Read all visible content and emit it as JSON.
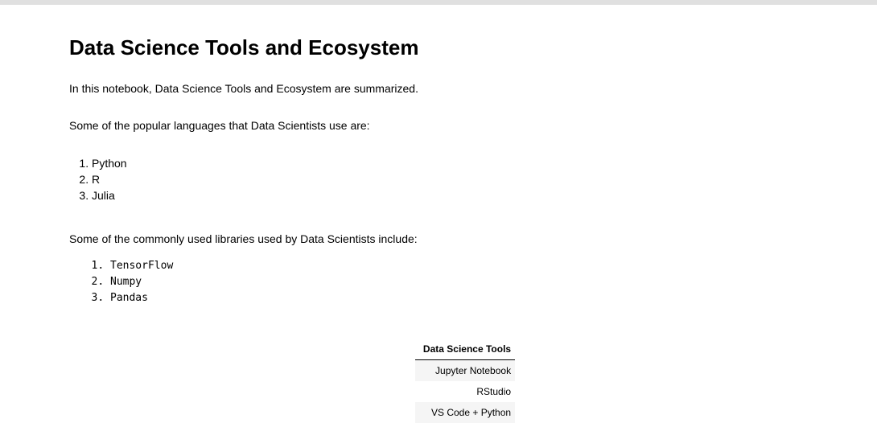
{
  "notebook": {
    "title": "Data Science Tools and Ecosystem",
    "intro": "In this notebook, Data Science Tools and Ecosystem are summarized.",
    "languages_heading": "Some of the popular languages that Data Scientists use are:",
    "languages": [
      "Python",
      "R",
      "Julia"
    ],
    "libraries_heading": "Some of the commonly used libraries used by Data Scientists include:",
    "libraries": [
      "TensorFlow",
      "Numpy",
      "Pandas"
    ],
    "tools_table": {
      "header": "Data Science Tools",
      "rows": [
        "Jupyter Notebook",
        "RStudio",
        "VS Code + Python"
      ]
    }
  }
}
